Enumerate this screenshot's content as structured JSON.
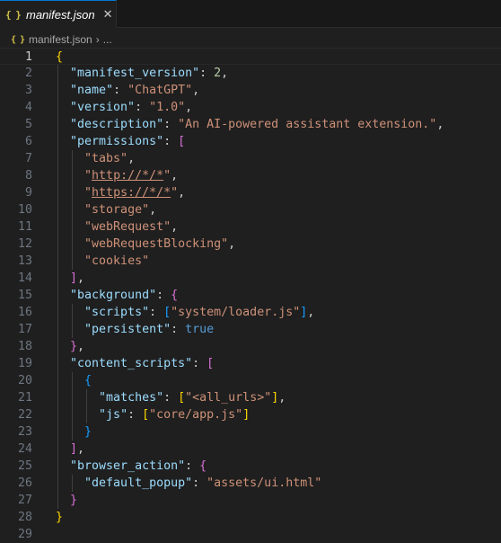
{
  "tab": {
    "title": "manifest.json",
    "icon": "json-icon",
    "close": "✕"
  },
  "breadcrumb": {
    "file": "manifest.json",
    "separator": "›",
    "ellipsis": "..."
  },
  "editor": {
    "current_line": 1,
    "lines": [
      [
        {
          "t": "{",
          "c": "br1"
        }
      ],
      [
        {
          "t": "  "
        },
        {
          "t": "\"manifest_version\"",
          "c": "k"
        },
        {
          "t": ": ",
          "c": "p"
        },
        {
          "t": "2",
          "c": "n"
        },
        {
          "t": ",",
          "c": "p"
        }
      ],
      [
        {
          "t": "  "
        },
        {
          "t": "\"name\"",
          "c": "k"
        },
        {
          "t": ": ",
          "c": "p"
        },
        {
          "t": "\"ChatGPT\"",
          "c": "s"
        },
        {
          "t": ",",
          "c": "p"
        }
      ],
      [
        {
          "t": "  "
        },
        {
          "t": "\"version\"",
          "c": "k"
        },
        {
          "t": ": ",
          "c": "p"
        },
        {
          "t": "\"1.0\"",
          "c": "s"
        },
        {
          "t": ",",
          "c": "p"
        }
      ],
      [
        {
          "t": "  "
        },
        {
          "t": "\"description\"",
          "c": "k"
        },
        {
          "t": ": ",
          "c": "p"
        },
        {
          "t": "\"An AI-powered assistant extension.\"",
          "c": "s"
        },
        {
          "t": ",",
          "c": "p"
        }
      ],
      [
        {
          "t": "  "
        },
        {
          "t": "\"permissions\"",
          "c": "k"
        },
        {
          "t": ": ",
          "c": "p"
        },
        {
          "t": "[",
          "c": "br2"
        }
      ],
      [
        {
          "t": "    "
        },
        {
          "t": "\"tabs\"",
          "c": "s"
        },
        {
          "t": ",",
          "c": "p"
        }
      ],
      [
        {
          "t": "    "
        },
        {
          "t": "\"",
          "c": "s"
        },
        {
          "t": "http://*/*",
          "c": "u"
        },
        {
          "t": "\"",
          "c": "s"
        },
        {
          "t": ",",
          "c": "p"
        }
      ],
      [
        {
          "t": "    "
        },
        {
          "t": "\"",
          "c": "s"
        },
        {
          "t": "https://*/*",
          "c": "u"
        },
        {
          "t": "\"",
          "c": "s"
        },
        {
          "t": ",",
          "c": "p"
        }
      ],
      [
        {
          "t": "    "
        },
        {
          "t": "\"storage\"",
          "c": "s"
        },
        {
          "t": ",",
          "c": "p"
        }
      ],
      [
        {
          "t": "    "
        },
        {
          "t": "\"webRequest\"",
          "c": "s"
        },
        {
          "t": ",",
          "c": "p"
        }
      ],
      [
        {
          "t": "    "
        },
        {
          "t": "\"webRequestBlocking\"",
          "c": "s"
        },
        {
          "t": ",",
          "c": "p"
        }
      ],
      [
        {
          "t": "    "
        },
        {
          "t": "\"cookies\"",
          "c": "s"
        }
      ],
      [
        {
          "t": "  "
        },
        {
          "t": "]",
          "c": "br2"
        },
        {
          "t": ",",
          "c": "p"
        }
      ],
      [
        {
          "t": "  "
        },
        {
          "t": "\"background\"",
          "c": "k"
        },
        {
          "t": ": ",
          "c": "p"
        },
        {
          "t": "{",
          "c": "br2"
        }
      ],
      [
        {
          "t": "    "
        },
        {
          "t": "\"scripts\"",
          "c": "k"
        },
        {
          "t": ": ",
          "c": "p"
        },
        {
          "t": "[",
          "c": "br3"
        },
        {
          "t": "\"system/loader.js\"",
          "c": "s"
        },
        {
          "t": "]",
          "c": "br3"
        },
        {
          "t": ",",
          "c": "p"
        }
      ],
      [
        {
          "t": "    "
        },
        {
          "t": "\"persistent\"",
          "c": "k"
        },
        {
          "t": ": ",
          "c": "p"
        },
        {
          "t": "true",
          "c": "b"
        }
      ],
      [
        {
          "t": "  "
        },
        {
          "t": "}",
          "c": "br2"
        },
        {
          "t": ",",
          "c": "p"
        }
      ],
      [
        {
          "t": "  "
        },
        {
          "t": "\"content_scripts\"",
          "c": "k"
        },
        {
          "t": ": ",
          "c": "p"
        },
        {
          "t": "[",
          "c": "br2"
        }
      ],
      [
        {
          "t": "    "
        },
        {
          "t": "{",
          "c": "br3"
        }
      ],
      [
        {
          "t": "      "
        },
        {
          "t": "\"matches\"",
          "c": "k"
        },
        {
          "t": ": ",
          "c": "p"
        },
        {
          "t": "[",
          "c": "br1"
        },
        {
          "t": "\"<all_urls>\"",
          "c": "s"
        },
        {
          "t": "]",
          "c": "br1"
        },
        {
          "t": ",",
          "c": "p"
        }
      ],
      [
        {
          "t": "      "
        },
        {
          "t": "\"js\"",
          "c": "k"
        },
        {
          "t": ": ",
          "c": "p"
        },
        {
          "t": "[",
          "c": "br1"
        },
        {
          "t": "\"core/app.js\"",
          "c": "s"
        },
        {
          "t": "]",
          "c": "br1"
        }
      ],
      [
        {
          "t": "    "
        },
        {
          "t": "}",
          "c": "br3"
        }
      ],
      [
        {
          "t": "  "
        },
        {
          "t": "]",
          "c": "br2"
        },
        {
          "t": ",",
          "c": "p"
        }
      ],
      [
        {
          "t": "  "
        },
        {
          "t": "\"browser_action\"",
          "c": "k"
        },
        {
          "t": ": ",
          "c": "p"
        },
        {
          "t": "{",
          "c": "br2"
        }
      ],
      [
        {
          "t": "    "
        },
        {
          "t": "\"default_popup\"",
          "c": "k"
        },
        {
          "t": ": ",
          "c": "p"
        },
        {
          "t": "\"assets/ui.html\"",
          "c": "s"
        }
      ],
      [
        {
          "t": "  "
        },
        {
          "t": "}",
          "c": "br2"
        }
      ],
      [
        {
          "t": "}",
          "c": "br1"
        }
      ],
      []
    ]
  }
}
